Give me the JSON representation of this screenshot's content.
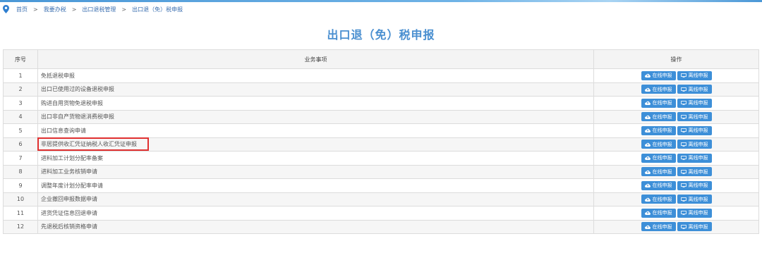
{
  "breadcrumb": {
    "items": [
      "首页",
      "我要办税",
      "出口退税管理"
    ],
    "current": "出口退（免）税申报",
    "separator": ">"
  },
  "page_title": "出口退（免）税申报",
  "table": {
    "headers": {
      "seq": "序号",
      "item": "业务事项",
      "ops": "操作"
    },
    "online_label": "在线申报",
    "offline_label": "离线申报",
    "rows": [
      {
        "seq": "1",
        "item": "免抵退税申报"
      },
      {
        "seq": "2",
        "item": "出口已使用过的设备退税申报"
      },
      {
        "seq": "3",
        "item": "购进自用货物免退税申报"
      },
      {
        "seq": "4",
        "item": "出口非自产货物退消费税申报"
      },
      {
        "seq": "5",
        "item": "出口信息查询申请"
      },
      {
        "seq": "6",
        "item": "非居提供收汇凭证纳税人收汇凭证申报"
      },
      {
        "seq": "7",
        "item": "进料加工计划分配率备案"
      },
      {
        "seq": "8",
        "item": "进料加工业务核销申请"
      },
      {
        "seq": "9",
        "item": "调整年度计划分配率申请"
      },
      {
        "seq": "10",
        "item": "企业撤回申报数据申请"
      },
      {
        "seq": "11",
        "item": "进货凭证信息回退申请"
      },
      {
        "seq": "12",
        "item": "先退税后核销资格申请"
      }
    ]
  },
  "colors": {
    "accent": "#3d8fd8",
    "title": "#4a8fd0",
    "highlight": "#e03030"
  }
}
